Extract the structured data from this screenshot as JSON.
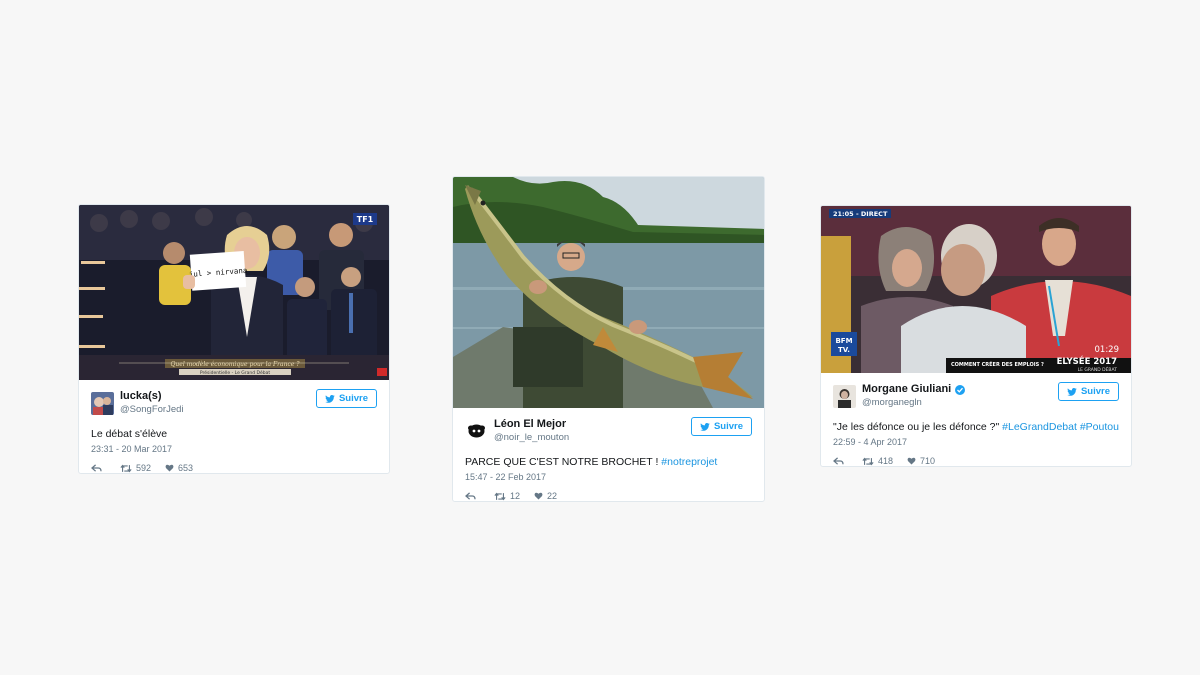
{
  "tweets": [
    {
      "name": "lucka(s)",
      "handle": "@SongForJedi",
      "follow_label": "Suivre",
      "text": "Le débat s'élève",
      "date": "23:31 - 20 Mar 2017",
      "retweets": "592",
      "likes": "653",
      "media": {
        "sign_text": "jul > nirvana",
        "banner": "Quel modèle économique pour la France ?",
        "sub_banner": "Présidentielle - Le Grand Débat",
        "logo": "TF1"
      }
    },
    {
      "name": "Léon El Mejor",
      "handle": "@noir_le_mouton",
      "follow_label": "Suivre",
      "text": "PARCE QUE C'EST NOTRE BROCHET !",
      "hashtag": "#notreprojet",
      "date": "15:47 - 22 Feb 2017",
      "retweets": "12",
      "likes": "22"
    },
    {
      "name": "Morgane Giuliani",
      "handle": "@morganegln",
      "follow_label": "Suivre",
      "text": "\"Je les défonce ou je les défonce ?\"",
      "hashtag1": "#LeGrandDebat",
      "hashtag2": "#Poutou",
      "date": "22:59 - 4 Apr 2017",
      "retweets": "418",
      "likes": "710",
      "media": {
        "live": "21:05 - DIRECT",
        "channel": "BFM TV.",
        "time": "01:29",
        "ticker": "COMMENT CRÉER DES EMPLOIS ?",
        "show": "ELYSÉE 2017",
        "show_sub": "LE GRAND DÉBAT"
      }
    }
  ],
  "colors": {
    "accent": "#1da1f2",
    "link": "#1b95e0",
    "muted": "#657786",
    "border": "#e1e8ed"
  }
}
